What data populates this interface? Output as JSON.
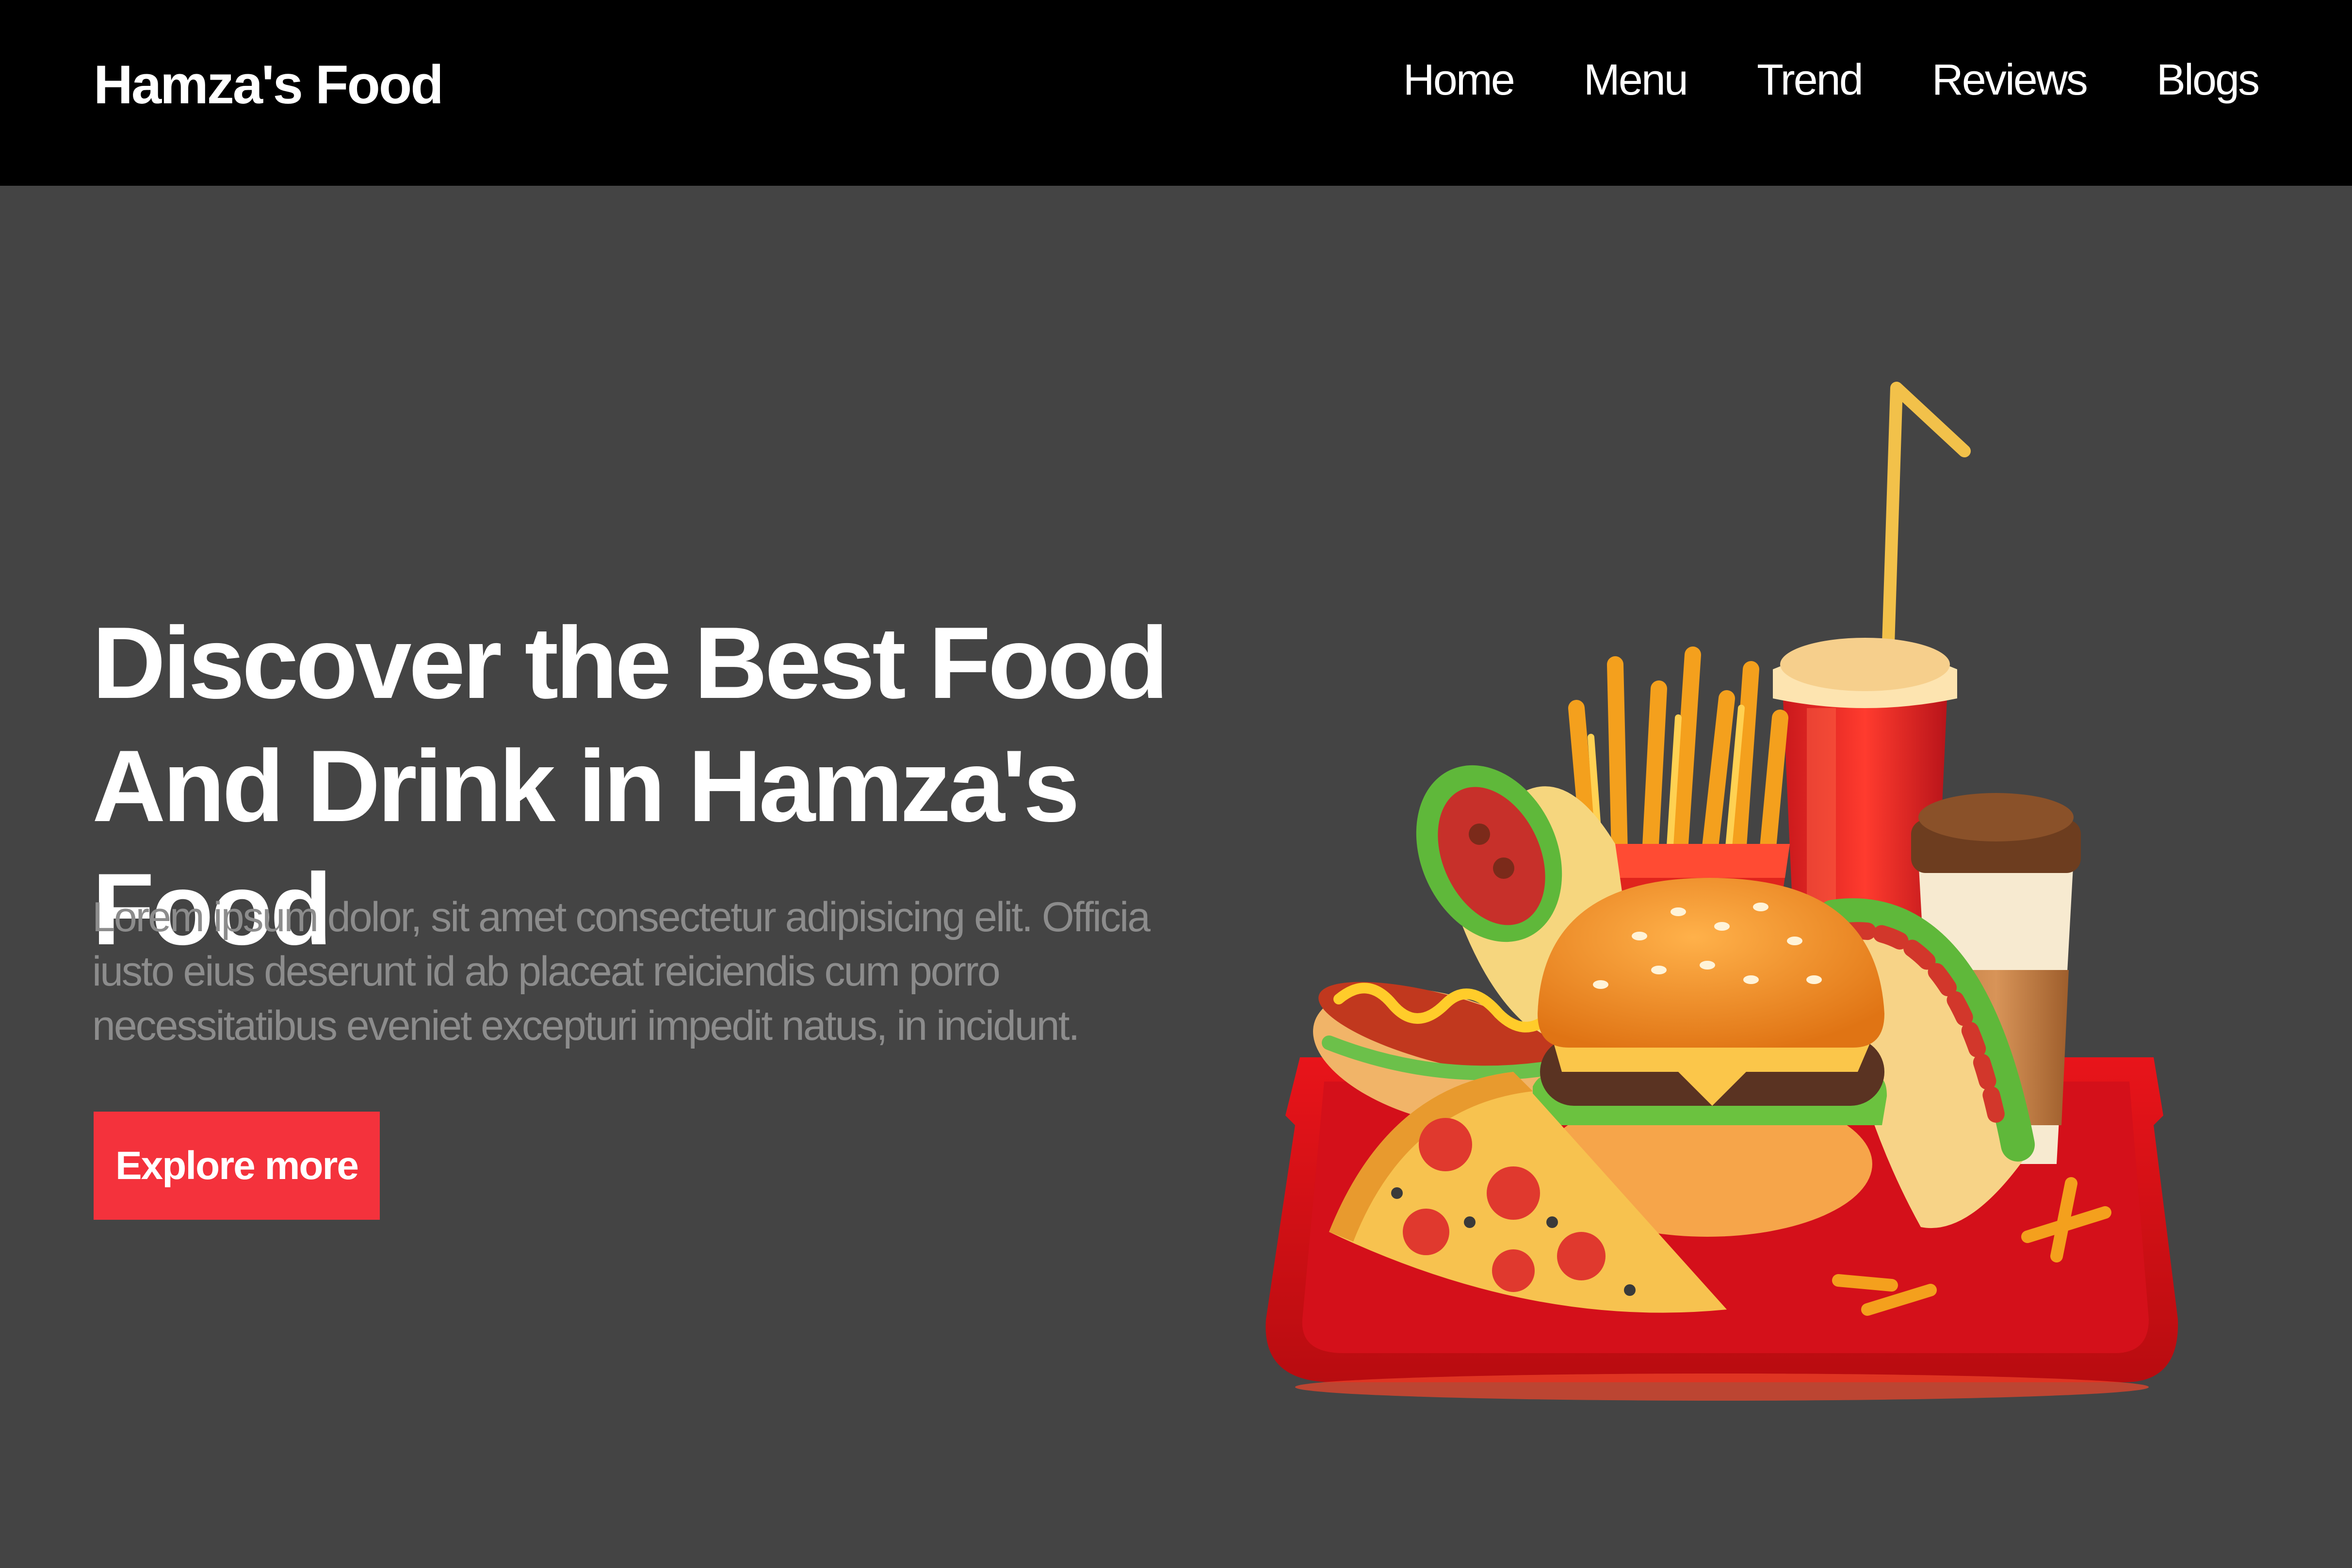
{
  "header": {
    "brand": "Hamza's Food",
    "nav": [
      {
        "label": "Home"
      },
      {
        "label": "Menu"
      },
      {
        "label": "Trend"
      },
      {
        "label": "Reviews"
      },
      {
        "label": "Blogs"
      }
    ]
  },
  "hero": {
    "title": "Discover the Best Food And Drink in Hamza's Food",
    "text": "Lorem ipsum dolor, sit amet consectetur adipisicing elit. Officia iusto eius deserunt id ab placeat reiciendis cum porro necessitatibus eveniet excepturi impedit natus, in incidunt.",
    "cta_label": "Explore more"
  },
  "colors": {
    "header_bg": "#000000",
    "page_bg": "#444444",
    "accent": "#f4323c",
    "body_text": "#8c8c8c"
  },
  "illustration": {
    "icon": "fast-food-tray-illustration"
  }
}
